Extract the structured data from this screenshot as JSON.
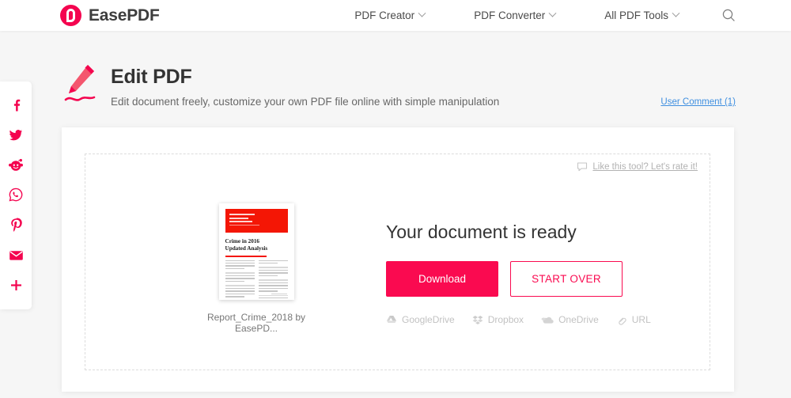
{
  "brand": {
    "name": "EasePDF",
    "logo_icon": "easepdf-logo-icon"
  },
  "nav": {
    "items": [
      {
        "label": "PDF Creator",
        "caret": "chevron-down-icon"
      },
      {
        "label": "PDF Converter",
        "caret": "chevron-down-icon"
      },
      {
        "label": "All PDF Tools",
        "caret": "chevron-down-icon"
      }
    ],
    "search_icon": "search-icon"
  },
  "social": {
    "items": [
      {
        "name": "facebook-icon",
        "label": "Facebook"
      },
      {
        "name": "twitter-icon",
        "label": "Twitter"
      },
      {
        "name": "reddit-icon",
        "label": "Reddit"
      },
      {
        "name": "whatsapp-icon",
        "label": "WhatsApp"
      },
      {
        "name": "pinterest-icon",
        "label": "Pinterest"
      },
      {
        "name": "email-icon",
        "label": "Email"
      },
      {
        "name": "plus-icon",
        "label": "More"
      }
    ],
    "accent_color": "#f4044f"
  },
  "tool": {
    "icon": "pencil-edit-icon",
    "title": "Edit PDF",
    "subtitle": "Edit document freely, customize your own PDF file online with simple manipulation",
    "user_comment_label": "User Comment (1)",
    "user_comment_color": "#3f8fe0"
  },
  "card": {
    "rate": {
      "icon": "speech-bubble-icon",
      "label": "Like this tool? Let's rate it!"
    },
    "document": {
      "file_name": "Report_Crime_2018 by EasePD...",
      "preview_title_line1": "Crime in 2016",
      "preview_title_line2": "Updated Analysis",
      "preview_header_color": "#f41605"
    },
    "ready": {
      "heading": "Your document is ready",
      "download_label": "Download",
      "start_over_label": "START OVER",
      "primary_color": "#fa0a50"
    },
    "cloud_targets": [
      {
        "icon": "google-drive-icon",
        "label": "GoogleDrive"
      },
      {
        "icon": "dropbox-icon",
        "label": "Dropbox"
      },
      {
        "icon": "onedrive-icon",
        "label": "OneDrive"
      },
      {
        "icon": "link-icon",
        "label": "URL"
      }
    ]
  }
}
